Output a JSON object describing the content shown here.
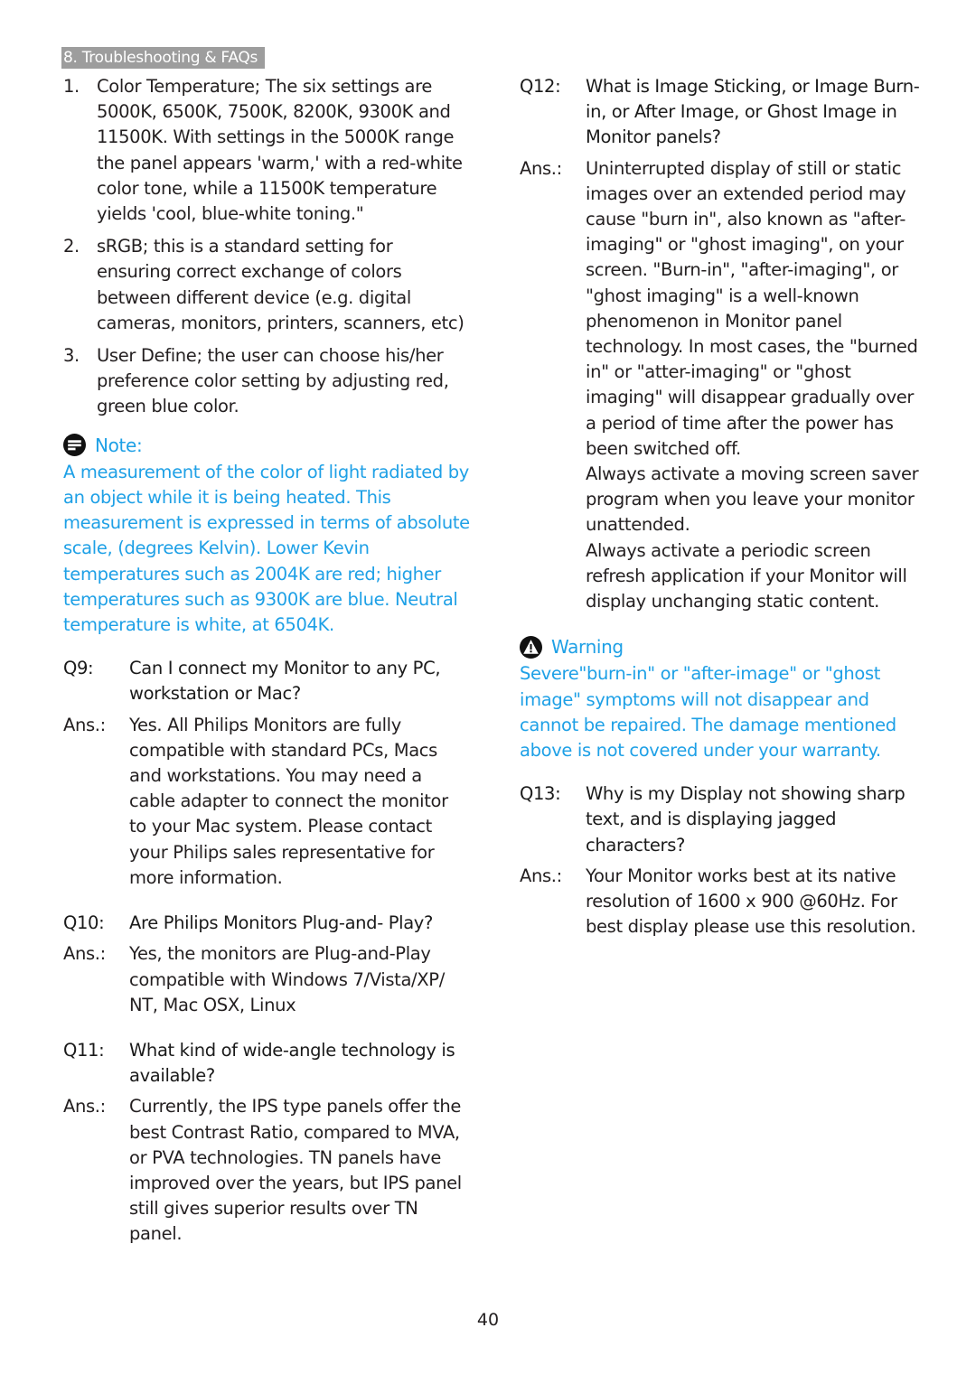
{
  "header": {
    "section_tab": "8. Troubleshooting & FAQs"
  },
  "left_column": {
    "numbered_items": [
      {
        "number": "1.",
        "text": "Color Temperature; The six settings are 5000K, 6500K, 7500K, 8200K, 9300K and 11500K. With settings in the 5000K range the panel appears 'warm,' with a red-white color tone, while a 11500K temperature yields 'cool, blue-white toning.\""
      },
      {
        "number": "2.",
        "text": "sRGB; this is a standard setting for ensuring correct exchange of colors between different device (e.g. digital cameras, monitors, printers, scanners, etc)"
      },
      {
        "number": "3.",
        "text": "User Define; the user can choose his/her preference color setting by adjusting red, green blue color."
      }
    ],
    "note": {
      "icon": "note-icon",
      "title": "Note:",
      "body": "A measurement of the color of light radiated by an object while it is being heated. This measurement is expressed in terms of absolute scale, (degrees Kelvin). Lower Kevin temperatures such as 2004K are red; higher temperatures such as 9300K are blue. Neutral temperature is white, at 6504K."
    },
    "faqs": [
      {
        "q_label": "Q9:",
        "question": "Can I connect my Monitor to any PC, workstation or Mac?",
        "a_label": "Ans.:",
        "answer": [
          "Yes. All Philips Monitors are fully compatible with standard PCs, Macs and workstations. You may need a cable adapter to connect the monitor to your Mac system. Please contact your Philips sales representative for more information."
        ]
      },
      {
        "q_label": "Q10:",
        "question": "Are Philips Monitors Plug-and- Play?",
        "a_label": "Ans.:",
        "answer": [
          "Yes, the monitors are Plug-and-Play compatible with Windows 7/Vista/XP/ NT, Mac OSX, Linux"
        ]
      },
      {
        "q_label": "Q11:",
        "question": "What kind of wide-angle technology is available?",
        "a_label": "Ans.:",
        "answer": [
          "Currently, the IPS type panels offer the best Contrast Ratio, compared to MVA, or PVA technologies.  TN panels have improved over the years, but IPS panel still gives superior results over TN panel."
        ]
      }
    ]
  },
  "right_column": {
    "faqs": [
      {
        "q_label": "Q12:",
        "question": "What is Image Sticking, or Image Burn-in, or After Image, or Ghost Image in Monitor panels?",
        "a_label": "Ans.:",
        "answer": [
          "Uninterrupted display of still or static images over an extended period may cause \"burn in\", also known as \"after-imaging\" or \"ghost imaging\", on your screen. \"Burn-in\", \"after-imaging\", or \"ghost imaging\" is a well-known phenomenon in Monitor panel technology. In most cases, the \"burned in\" or \"atter-imaging\" or \"ghost imaging\" will disappear gradually over a period of time after the power has been switched off.",
          "Always activate a moving screen saver program when you leave your monitor unattended.",
          "Always activate a periodic screen refresh application if your Monitor will display unchanging static content."
        ]
      }
    ],
    "warning": {
      "icon": "warning-icon",
      "title": "Warning",
      "body": "Severe\"burn-in\" or \"after-image\" or \"ghost image\" symptoms will not disappear and cannot be repaired. The damage mentioned above is not covered under your warranty."
    },
    "faqs_after_warning": [
      {
        "q_label": "Q13:",
        "question": "Why is my Display not showing sharp text, and is displaying jagged characters?",
        "a_label": "Ans.:",
        "answer": [
          "Your Monitor works best at its native resolution of 1600 x 900 @60Hz. For best display please use this resolution."
        ]
      }
    ]
  },
  "footer": {
    "page_number": "40"
  },
  "colors": {
    "callout_blue": "#1ea0e6",
    "header_tab_gray": "#9d9d9d",
    "text": "#231f20"
  }
}
